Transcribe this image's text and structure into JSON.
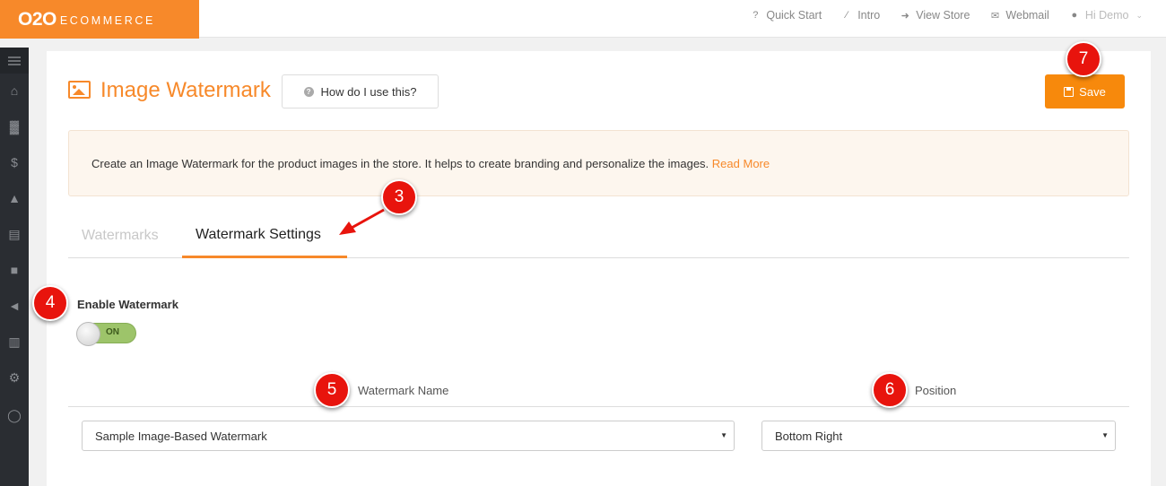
{
  "brand": {
    "logo_o2o": "O2O",
    "logo_ecommerce": "ECOMMERCE"
  },
  "topnav": [
    {
      "label": "Quick Start",
      "icon": "question-icon"
    },
    {
      "label": "Intro",
      "icon": "magic-wand-icon"
    },
    {
      "label": "View Store",
      "icon": "sign-in-icon"
    },
    {
      "label": "Webmail",
      "icon": "envelope-icon"
    },
    {
      "label": "Hi Demo",
      "icon": "user-icon"
    }
  ],
  "sidebar": {
    "icons": [
      "menu-icon",
      "home-icon",
      "cart-icon",
      "dollar-icon",
      "user-icon",
      "book-icon",
      "thumbs-up-icon",
      "megaphone-icon",
      "bar-chart-icon",
      "cogs-icon",
      "chat-icon"
    ]
  },
  "page": {
    "title": "Image Watermark",
    "help_label": "How do I use this?",
    "save_label": "Save",
    "info_text": "Create an Image Watermark for the product images in the store. It helps to create branding and personalize the images.",
    "info_link": "Read More"
  },
  "tabs": [
    {
      "label": "Watermarks",
      "active": false
    },
    {
      "label": "Watermark Settings",
      "active": true
    }
  ],
  "settings": {
    "enable_label": "Enable Watermark",
    "toggle_state": "ON",
    "watermark_name_label": "Watermark Name",
    "position_label": "Position",
    "watermark_name_value": "Sample Image-Based Watermark",
    "position_value": "Bottom Right"
  },
  "markers": [
    "3",
    "4",
    "5",
    "6",
    "7"
  ],
  "colors": {
    "accent": "#f7892a",
    "save": "#f7890c",
    "marker": "#e8140d",
    "toggle_on": "#9dc46a",
    "sidebar": "#2a2d32"
  }
}
